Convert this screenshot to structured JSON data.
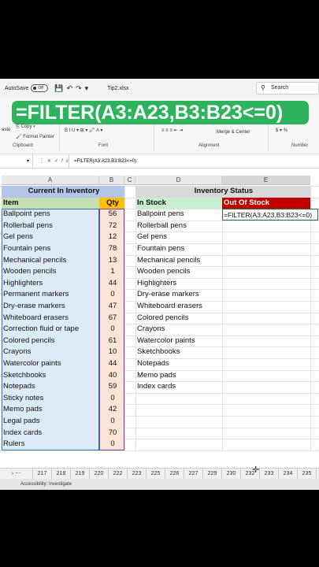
{
  "titlebar": {
    "autosave_label": "AutoSave",
    "autosave_state": "Off",
    "filename": "Tip2.xlsx",
    "search_placeholder": "Search"
  },
  "banner": {
    "formula": "=FILTER(A3:A23,B3:B23<=0)"
  },
  "ribbon": {
    "copy_label": "Copy",
    "format_painter_label": "Format Painter",
    "paste_label": "aste",
    "merge_label": "Merge & Center",
    "groups": {
      "clipboard": "Clipboard",
      "font": "Font",
      "alignment": "Alignment",
      "number": "Number"
    }
  },
  "formula_bar": {
    "name_box": "",
    "content": "=FILTER(A3:A23,B3:B23<=0)"
  },
  "columns": [
    "A",
    "B",
    "C",
    "D",
    "E"
  ],
  "inventory": {
    "title": "Current In Inventory",
    "item_header": "Item",
    "qty_header": "Qty",
    "rows": [
      {
        "item": "Ballpoint pens",
        "qty": "56"
      },
      {
        "item": "Rollerball pens",
        "qty": "72"
      },
      {
        "item": "Gel pens",
        "qty": "12"
      },
      {
        "item": "Fountain pens",
        "qty": "78"
      },
      {
        "item": "Mechanical pencils",
        "qty": "13"
      },
      {
        "item": "Wooden pencils",
        "qty": "1"
      },
      {
        "item": "Highlighters",
        "qty": "44"
      },
      {
        "item": "Permanent markers",
        "qty": "0"
      },
      {
        "item": "Dry-erase markers",
        "qty": "47"
      },
      {
        "item": "Whiteboard erasers",
        "qty": "67"
      },
      {
        "item": "Correction fluid or tape",
        "qty": "0"
      },
      {
        "item": "Colored pencils",
        "qty": "61"
      },
      {
        "item": "Crayons",
        "qty": "10"
      },
      {
        "item": "Watercolor paints",
        "qty": "44"
      },
      {
        "item": "Sketchbooks",
        "qty": "40"
      },
      {
        "item": "Notepads",
        "qty": "59"
      },
      {
        "item": "Sticky notes",
        "qty": "0"
      },
      {
        "item": "Memo pads",
        "qty": "42"
      },
      {
        "item": "Legal pads",
        "qty": "0"
      },
      {
        "item": "Index cards",
        "qty": "70"
      },
      {
        "item": "Rulers",
        "qty": "0"
      }
    ]
  },
  "status": {
    "title": "Inventory Status",
    "in_stock_header": "In Stock",
    "out_of_stock_header": "Out Of Stock",
    "editing_formula": "=FILTER(A3:A23,B3:B23<=0)",
    "in_stock": [
      "Ballpoint pens",
      "Rollerball pens",
      "Gel pens",
      "Fountain pens",
      "Mechanical pencils",
      "Wooden pencils",
      "Highlighters",
      "Dry-erase markers",
      "Whiteboard erasers",
      "Colored pencils",
      "Crayons",
      "Watercolor paints",
      "Sketchbooks",
      "Notepads",
      "Memo pads",
      "Index cards"
    ]
  },
  "row_numbers": [
    "217",
    "218",
    "219",
    "220",
    "222",
    "223",
    "225",
    "226",
    "227",
    "229",
    "230",
    "232",
    "233",
    "234",
    "235"
  ],
  "statusbar": {
    "accessibility": "Accessibility: Investigate"
  }
}
